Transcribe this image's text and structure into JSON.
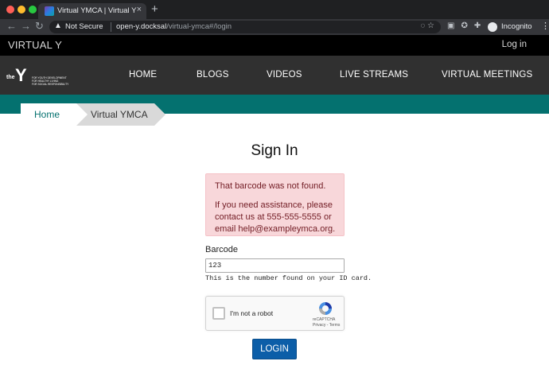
{
  "browser": {
    "tab_title": "Virtual YMCA | Virtual Y",
    "tab_close": "×",
    "new_tab": "+",
    "security_label": "Not Secure",
    "url_host": "open-y.docksal",
    "url_path": "/virtual-ymca#/login",
    "profile_label": "Incognito"
  },
  "site": {
    "brand": "VIRTUAL Y",
    "login_link": "Log in",
    "logo": {
      "the": "the",
      "y": "Y",
      "tagline": [
        "FOR YOUTH DEVELOPMENT",
        "FOR HEALTHY LIVING",
        "FOR SOCIAL RESPONSIBILITY"
      ]
    },
    "nav": [
      "HOME",
      "BLOGS",
      "VIDEOS",
      "LIVE STREAMS",
      "VIRTUAL MEETINGS"
    ]
  },
  "breadcrumb": {
    "home": "Home",
    "current": "Virtual YMCA"
  },
  "signin": {
    "title": "Sign In",
    "alert_title": "That barcode was not found.",
    "alert_body": "If you need assistance, please contact us at 555-555-5555 or email help@exampleymca.org.",
    "barcode_label": "Barcode",
    "barcode_value": "123",
    "barcode_help": "This is the number found on your ID card.",
    "captcha_label": "I'm not a robot",
    "captcha_brand": "reCAPTCHA",
    "captcha_links": "Privacy - Terms",
    "login_button": "LOGIN"
  },
  "colors": {
    "teal": "#04716f",
    "nav_bg": "#303030",
    "alert_bg": "#f8d7da",
    "alert_text": "#721c24",
    "button": "#0c5ea8"
  }
}
